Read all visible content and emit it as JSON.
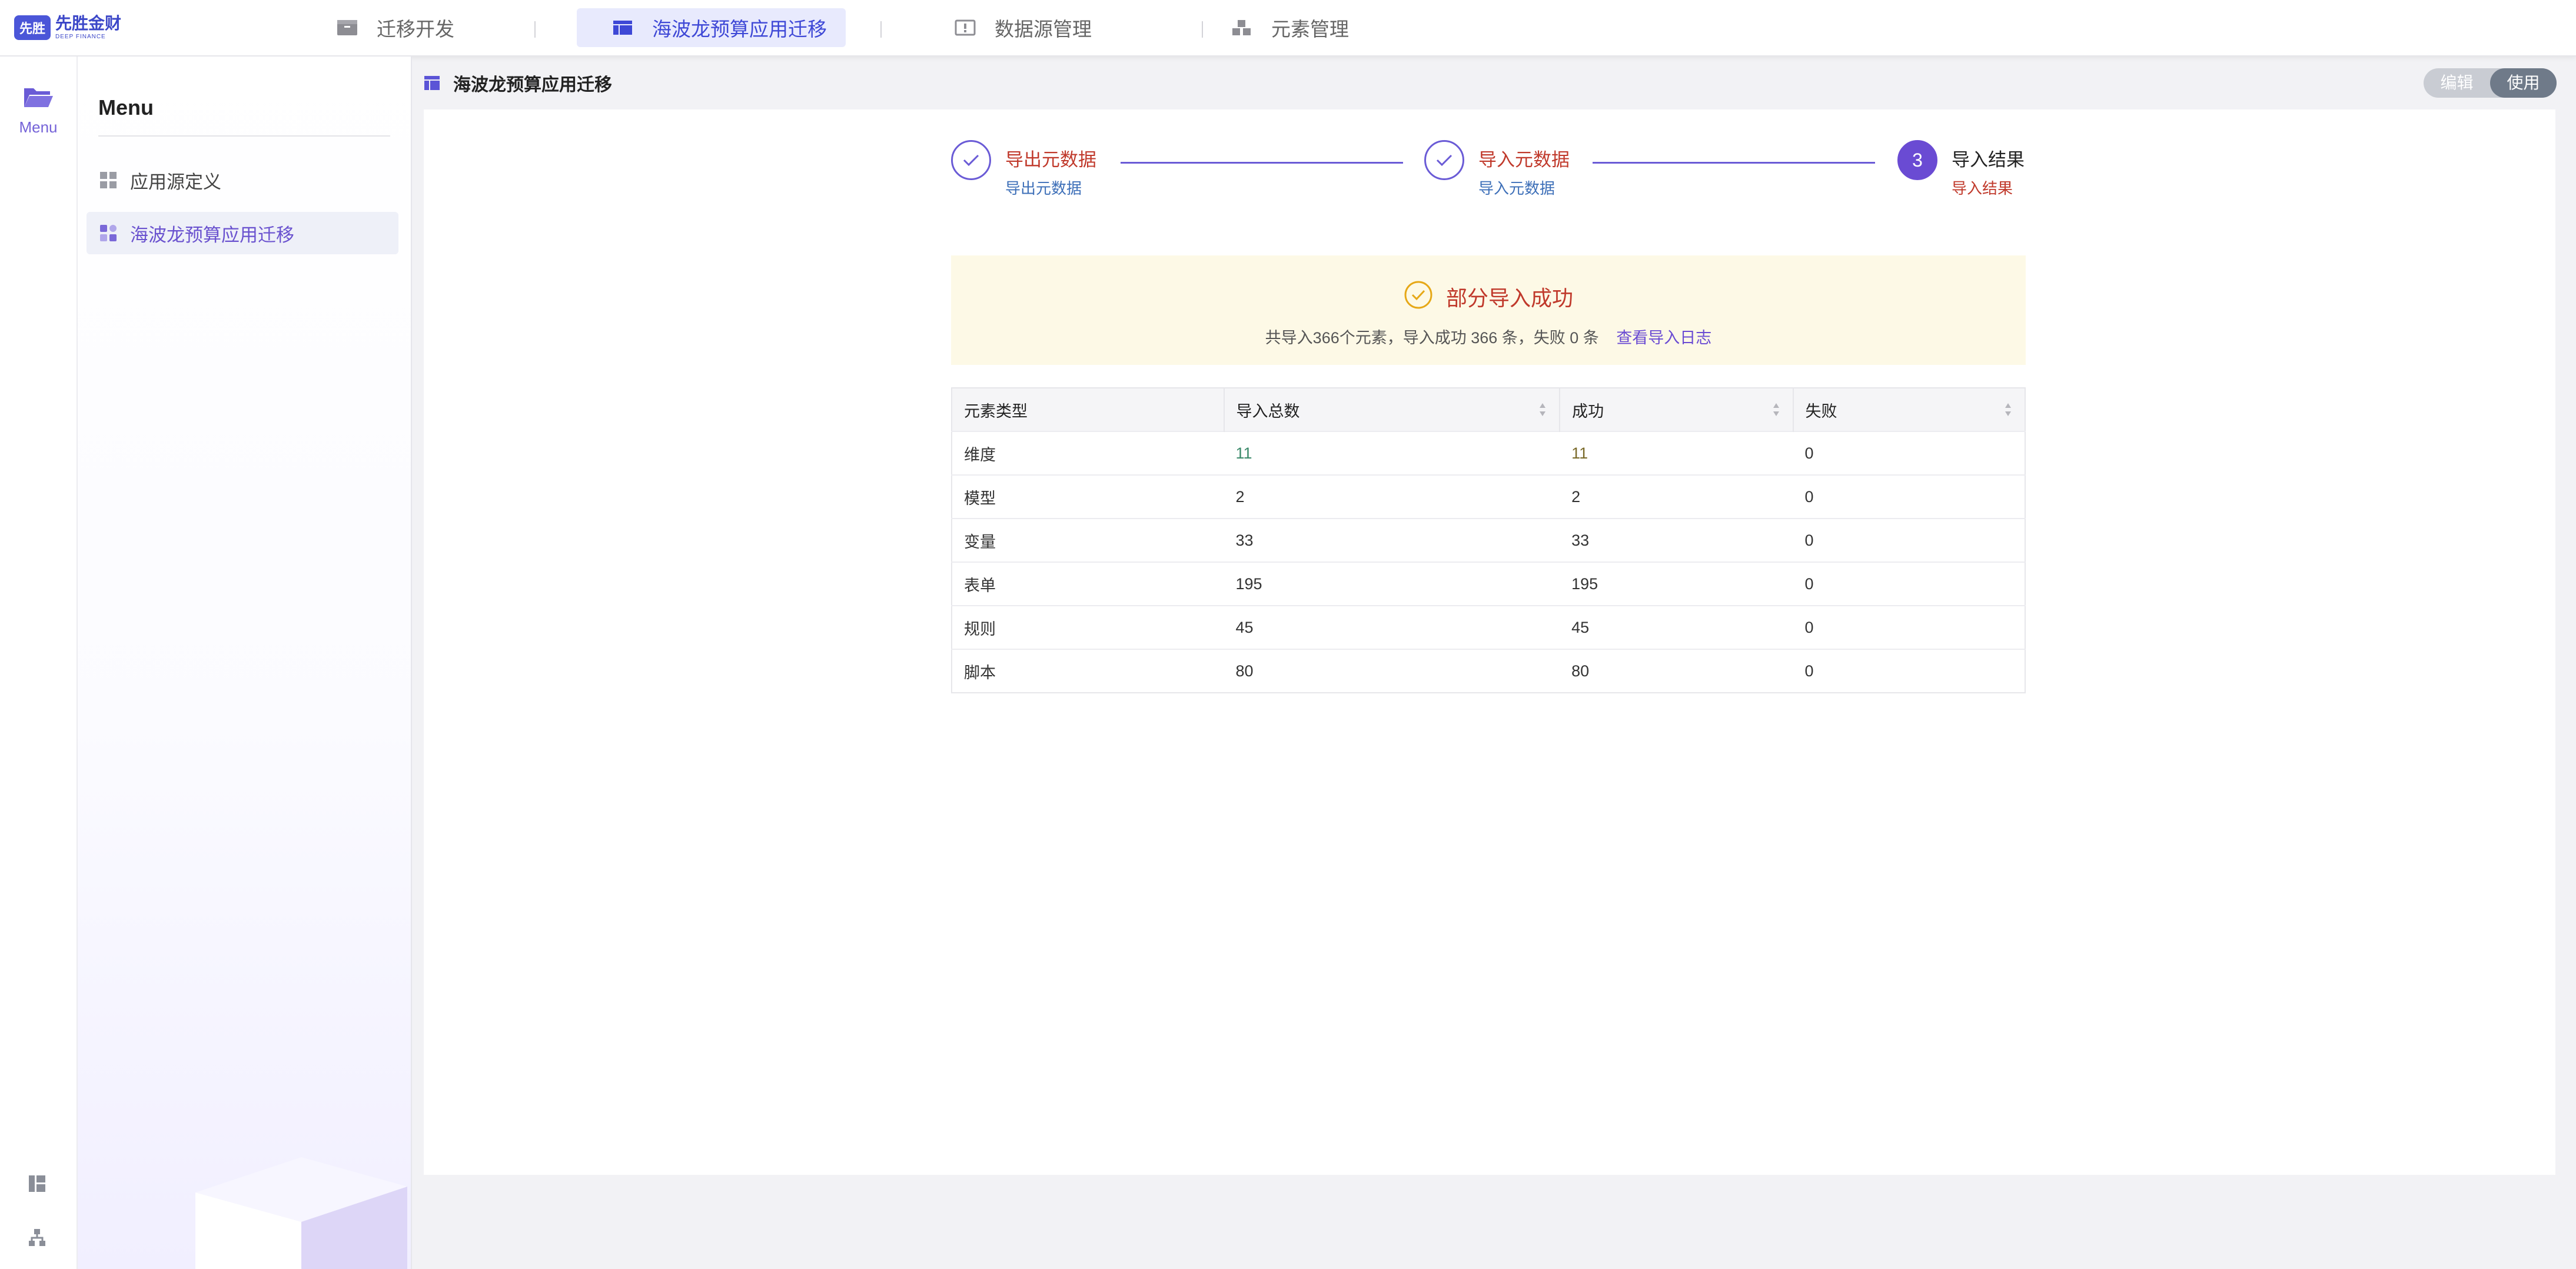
{
  "app": {
    "logo_cn": "先胜金财",
    "logo_en": "DEEP FINANCE",
    "logo_mark": "先胜"
  },
  "topnav": {
    "tabs": [
      {
        "label": "迁移开发",
        "icon": "folder-icon"
      },
      {
        "label": "海波龙预算应用迁移",
        "icon": "window-icon",
        "active": true
      },
      {
        "label": "数据源管理",
        "icon": "database-icon"
      },
      {
        "label": "元素管理",
        "icon": "blocks-icon"
      }
    ]
  },
  "rail": {
    "menu_label": "Menu"
  },
  "sidemenu": {
    "title": "Menu",
    "items": [
      {
        "label": "应用源定义",
        "icon": "grid-icon"
      },
      {
        "label": "海波龙预算应用迁移",
        "icon": "migrate-icon",
        "active": true
      }
    ]
  },
  "page": {
    "title": "海波龙预算应用迁移",
    "mode": {
      "edit": "编辑",
      "use": "使用",
      "active": "use"
    }
  },
  "steps": [
    {
      "title": "导出元数据",
      "desc": "导出元数据",
      "state": "done"
    },
    {
      "title": "导入元数据",
      "desc": "导入元数据",
      "state": "done"
    },
    {
      "number": "3",
      "title": "导入结果",
      "desc": "导入结果",
      "state": "current"
    }
  ],
  "result": {
    "title": "部分导入成功",
    "summary": "共导入366个元素，导入成功 366 条，失败  0  条",
    "log_link": "查看导入日志"
  },
  "table": {
    "headers": [
      "元素类型",
      "导入总数",
      "成功",
      "失败"
    ],
    "rows": [
      [
        "维度",
        "11",
        "11",
        "0"
      ],
      [
        "模型",
        "2",
        "2",
        "0"
      ],
      [
        "变量",
        "33",
        "33",
        "0"
      ],
      [
        "表单",
        "195",
        "195",
        "0"
      ],
      [
        "规则",
        "45",
        "45",
        "0"
      ],
      [
        "脚本",
        "80",
        "80",
        "0"
      ]
    ]
  },
  "colors": {
    "accent": "#6a4bd3",
    "nav_active": "#3e48d6",
    "step_done_text": "#c0392b",
    "step_desc": "#3d6fb8",
    "banner_bg": "#fdf9e6",
    "success_icon": "#e6a817"
  }
}
